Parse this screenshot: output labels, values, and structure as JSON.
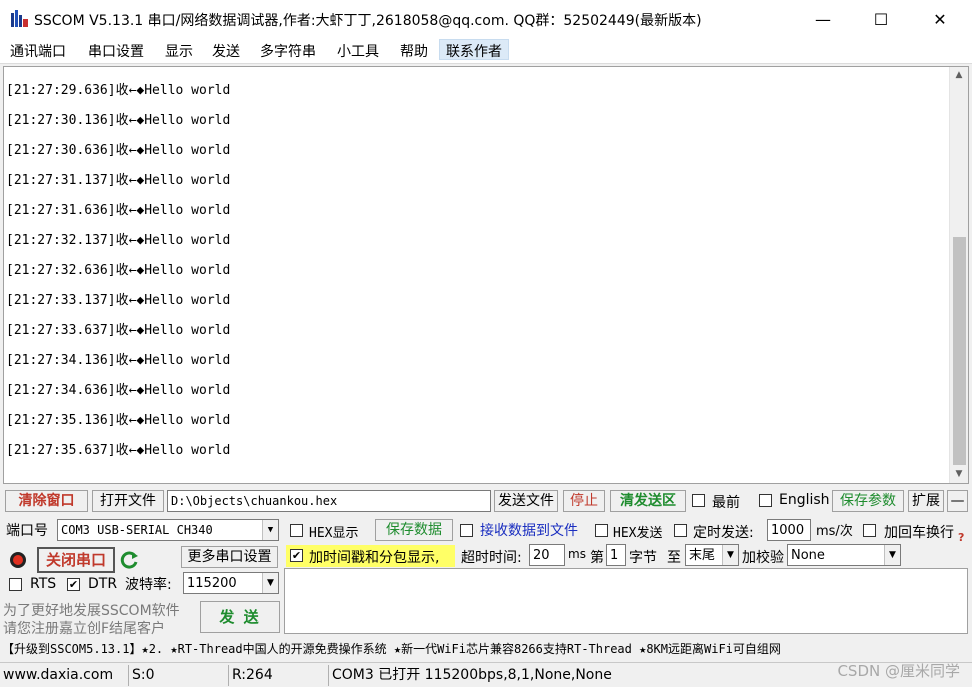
{
  "window": {
    "title": "SSCOM V5.13.1 串口/网络数据调试器,作者:大虾丁丁,2618058@qq.com. QQ群：52502449(最新版本)",
    "minimize_glyph": "—",
    "maximize_glyph": "☐",
    "close_glyph": "✕"
  },
  "menu": {
    "items": [
      "通讯端口",
      "串口设置",
      "显示",
      "发送",
      "多字符串",
      "小工具",
      "帮助",
      "联系作者"
    ]
  },
  "receive": {
    "lines": [
      "[21:27:29.636]收←◆Hello world",
      "[21:27:30.136]收←◆Hello world",
      "[21:27:30.636]收←◆Hello world",
      "[21:27:31.137]收←◆Hello world",
      "[21:27:31.636]收←◆Hello world",
      "[21:27:32.137]收←◆Hello world",
      "[21:27:32.636]收←◆Hello world",
      "[21:27:33.137]收←◆Hello world",
      "[21:27:33.637]收←◆Hello world",
      "[21:27:34.136]收←◆Hello world",
      "[21:27:34.636]收←◆Hello world",
      "[21:27:35.136]收←◆Hello world",
      "[21:27:35.637]收←◆Hello world"
    ]
  },
  "file_row": {
    "clear_label": "清除窗口",
    "open_file_label": "打开文件",
    "file_path": "D:\\Objects\\chuankou.hex",
    "send_file_label": "发送文件",
    "stop_label": "停止",
    "clear_send_label": "清发送区",
    "latest_label": "最前",
    "english_label": "English",
    "save_params_label": "保存参数",
    "expand_label": "扩展",
    "collapse_label": "—"
  },
  "port": {
    "port_label": "端口号",
    "port_value": "COM3 USB-SERIAL CH340",
    "close_port_label": "关闭串口",
    "more_settings_label": "更多串口设置",
    "rts_label": "RTS",
    "dtr_label": "DTR",
    "baud_label": "波特率:",
    "baud_value": "115200",
    "rts_checked": false,
    "dtr_checked": true
  },
  "options": {
    "hex_display_label": "HEX显示",
    "save_data_label": "保存数据",
    "recv_to_file_label": "接收数据到文件",
    "hex_send_label": "HEX发送",
    "timed_send_label": "定时发送:",
    "interval_value": "1000",
    "interval_unit": "ms/次",
    "add_crlf_label": "加回车换行",
    "timestamp_label": "加时间戳和分包显示,",
    "timeout_label": "超时时间:",
    "timeout_value": "20",
    "timeout_unit": "ms",
    "byte_prefix": "第",
    "byte_value": "1",
    "byte_label": "字节",
    "to_label": "至",
    "end_value": "末尾",
    "checksum_label": "加校验",
    "checksum_value": "None"
  },
  "promo": {
    "line1": "为了更好地发展SSCOM软件",
    "line2": "请您注册嘉立创F结尾客户",
    "send_label": "发 送"
  },
  "news": "【升级到SSCOM5.13.1】★2. ★RT-Thread中国人的开源免费操作系统 ★新一代WiFi芯片兼容8266支持RT-Thread ★8KM远距离WiFi可自组网",
  "status": {
    "website": "www.daxia.com",
    "sent": "S:0",
    "received": "R:264",
    "port_status": "COM3 已打开  115200bps,8,1,None,None"
  },
  "watermark": "CSDN @厘米同学",
  "colors": {
    "red_text": "#c0392b",
    "green_text": "#1e8c2e",
    "timestamp_highlight": "#ffff66"
  }
}
